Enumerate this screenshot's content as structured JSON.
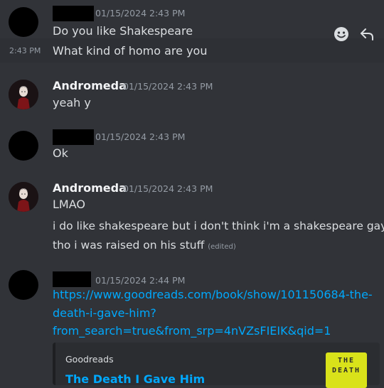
{
  "messages": [
    {
      "timestamp": "01/15/2024 2:43 PM",
      "lines": [
        "Do you like Shakespeare"
      ]
    },
    {
      "side_time": "2:43 PM",
      "lines": [
        "What kind of homo are you"
      ]
    },
    {
      "author": "Andromeda",
      "timestamp": "01/15/2024 2:43 PM",
      "lines": [
        "yeah y"
      ]
    },
    {
      "timestamp": "01/15/2024 2:43 PM",
      "lines": [
        "Ok"
      ]
    },
    {
      "author": "Andromeda",
      "timestamp": "01/15/2024 2:43 PM",
      "lines": [
        "LMAO",
        "i do like shakespeare but i don't think i'm a shakespeare gay",
        "tho i was raised on his stuff"
      ],
      "edited_label": "(edited)"
    },
    {
      "timestamp": "01/15/2024 2:44 PM",
      "link_lines": [
        "https://www.goodreads.com/book/show/101150684-the-",
        "death-i-gave-him?",
        "from_search=true&from_srp=4nVZsFIEIK&qid=1"
      ],
      "embed": {
        "provider": "Goodreads",
        "title": "The Death I Gave Him",
        "thumb_lines": [
          "THE",
          "DEATH"
        ]
      }
    }
  ],
  "colors": {
    "background": "#313338",
    "link": "#00a8fc",
    "timestamp": "#949ba4"
  },
  "hover_actions": [
    "add-reaction-icon",
    "reply-icon"
  ]
}
